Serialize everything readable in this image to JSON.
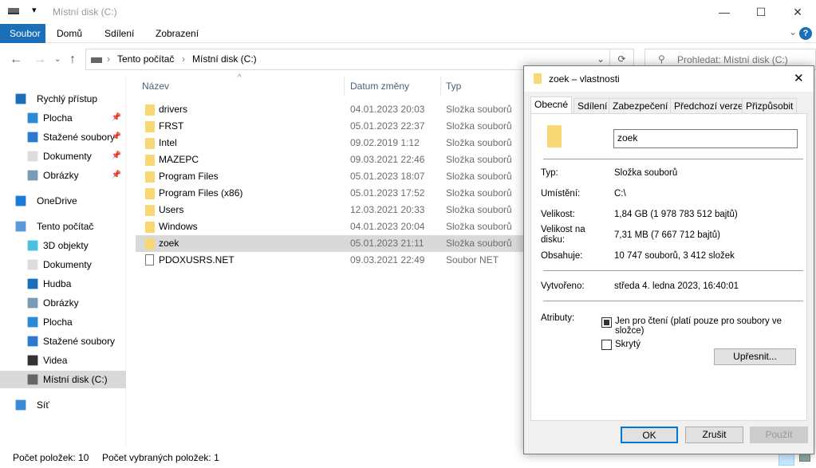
{
  "window": {
    "title": "Místní disk (C:)",
    "minimize": "—",
    "maximize": "☐",
    "close": "✕"
  },
  "ribbon": {
    "tabs": [
      "Soubor",
      "Domů",
      "Sdílení",
      "Zobrazení"
    ],
    "help": "?",
    "collapse": "⌄"
  },
  "address": {
    "crumbs": [
      "Tento počítač",
      "Místní disk (C:)"
    ],
    "search_placeholder": "Prohledat: Místní disk (C:)"
  },
  "sidebar": {
    "items": [
      {
        "label": "Rychlý přístup",
        "icon": "star-icon"
      },
      {
        "label": "Plocha",
        "icon": "desktop-icon",
        "pinned": true
      },
      {
        "label": "Stažené soubory",
        "icon": "download-icon",
        "pinned": true
      },
      {
        "label": "Dokumenty",
        "icon": "document-icon",
        "pinned": true
      },
      {
        "label": "Obrázky",
        "icon": "pictures-icon",
        "pinned": true
      },
      {
        "label": "OneDrive",
        "icon": "cloud-icon"
      },
      {
        "label": "Tento počítač",
        "icon": "computer-icon"
      },
      {
        "label": "3D objekty",
        "icon": "cube-icon"
      },
      {
        "label": "Dokumenty",
        "icon": "document-icon"
      },
      {
        "label": "Hudba",
        "icon": "music-icon"
      },
      {
        "label": "Obrázky",
        "icon": "pictures-icon"
      },
      {
        "label": "Plocha",
        "icon": "desktop-icon"
      },
      {
        "label": "Stažené soubory",
        "icon": "download-icon"
      },
      {
        "label": "Videa",
        "icon": "video-icon"
      },
      {
        "label": "Místní disk (C:)",
        "icon": "drive-icon"
      },
      {
        "label": "Síť",
        "icon": "network-icon"
      }
    ]
  },
  "list": {
    "columns": [
      "Název",
      "Datum změny",
      "Typ"
    ],
    "rows": [
      {
        "name": "drivers",
        "date": "04.01.2023 20:03",
        "type": "Složka souborů"
      },
      {
        "name": "FRST",
        "date": "05.01.2023 22:37",
        "type": "Složka souborů"
      },
      {
        "name": "Intel",
        "date": "09.02.2019 1:12",
        "type": "Složka souborů"
      },
      {
        "name": "MAZEPC",
        "date": "09.03.2021 22:46",
        "type": "Složka souborů"
      },
      {
        "name": "Program Files",
        "date": "05.01.2023 18:07",
        "type": "Složka souborů"
      },
      {
        "name": "Program Files (x86)",
        "date": "05.01.2023 17:52",
        "type": "Složka souborů"
      },
      {
        "name": "Users",
        "date": "12.03.2021 20:33",
        "type": "Složka souborů"
      },
      {
        "name": "Windows",
        "date": "04.01.2023 20:04",
        "type": "Složka souborů"
      },
      {
        "name": "zoek",
        "date": "05.01.2023 21:11",
        "type": "Složka souborů"
      },
      {
        "name": "PDOXUSRS.NET",
        "date": "09.03.2021 22:49",
        "type": "Soubor NET"
      }
    ]
  },
  "status": {
    "count": "Počet položek: 10",
    "selected": "Počet vybraných položek: 1"
  },
  "dialog": {
    "title": "zoek – vlastnosti",
    "close": "✕",
    "tabs": [
      "Obecné",
      "Sdílení",
      "Zabezpečení",
      "Předchozí verze",
      "Přizpůsobit"
    ],
    "name_value": "zoek",
    "fields": [
      {
        "label": "Typ:",
        "value": "Složka souborů"
      },
      {
        "label": "Umístění:",
        "value": "C:\\"
      },
      {
        "label": "Velikost:",
        "value": "1,84 GB (1 978 783 512 bajtů)"
      },
      {
        "label": "Velikost na disku:",
        "value": "7,31 MB (7 667 712 bajtů)"
      },
      {
        "label": "Obsahuje:",
        "value": "10 747 souborů, 3 412 složek"
      },
      {
        "label": "Vytvořeno:",
        "value": "středa 4. ledna 2023, 16:40:01"
      }
    ],
    "attributes_label": "Atributy:",
    "readonly_label": "Jen pro čtení (platí pouze pro soubory ve složce)",
    "hidden_label": "Skrytý",
    "advanced": "Upřesnit...",
    "ok": "OK",
    "cancel": "Zrušit",
    "apply": "Použít"
  }
}
